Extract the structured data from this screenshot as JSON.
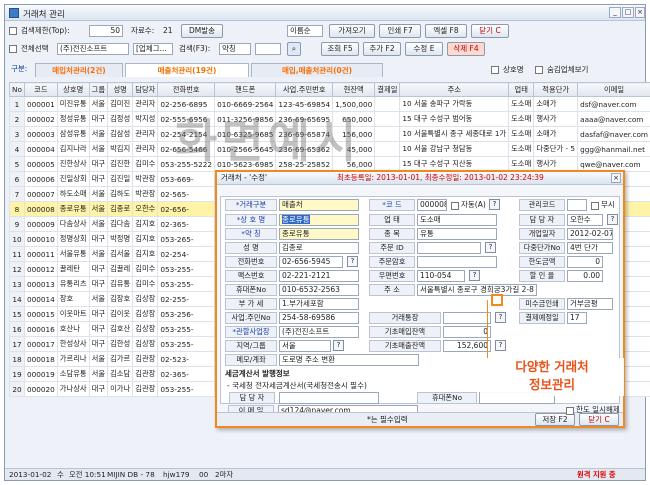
{
  "window": {
    "title": "거래처 관리"
  },
  "toolbar": {
    "chk_search_limit": "검색제한(Top):",
    "limit_value": "50",
    "data_count_label": "자료수:",
    "data_count": "21",
    "dm_button": "DM발송",
    "name_sort": "이름순",
    "btn_import": "가져오기",
    "btn_print": "인쇄 F7",
    "btn_excel": "엑셀 F8",
    "btn_close": "닫기 C",
    "chk_all_select": "전체선택",
    "company": "(주)전진소프트",
    "category": "[업체그...",
    "search_label": "검색(F3):",
    "search_field": "약칭",
    "search_value": "",
    "btn_search": "조회 F5",
    "btn_add": "추가 F2",
    "btn_edit": "수정 E",
    "btn_delete": "삭제 F4"
  },
  "tabs": {
    "label": "구분:",
    "items": [
      "매입처관리(2건)",
      "매출처관리(19건)",
      "매입,매출처관리(0건)"
    ]
  },
  "filters": {
    "chk_sangho": "상호명",
    "chk_show_disabled": "숨김업체보기"
  },
  "grid": {
    "headers": [
      "No",
      "코드",
      "상호명",
      "그룹",
      "성명",
      "담당자",
      "전화번호",
      "핸드폰",
      "사업.주민번호",
      "현잔액",
      "결제일",
      "주소",
      "업태",
      "적용단가",
      "이메일"
    ],
    "rows": [
      [
        "1",
        "000001",
        "미진유통",
        "서울",
        "김미진",
        "관리자",
        "02-256-6895",
        "010-6669-2564",
        "123-45-69854",
        "1,500,000",
        "",
        "10 서울 송파구 가락동",
        "도소매",
        "소매가",
        "dsf@naver.com"
      ],
      [
        "2",
        "000002",
        "정성유통",
        "대구",
        "김정성",
        "박지성",
        "02-555-6956",
        "011-3256-9856",
        "236-69-65695",
        "650,000",
        "",
        "15 대구 수성구 범어동",
        "도소매",
        "행사가",
        "aaaa@naver.com"
      ],
      [
        "3",
        "000003",
        "삼성유통",
        "서울",
        "김삼성",
        "관리자",
        "02-254-2154",
        "010-6325-9685",
        "236-69-65874",
        "156,000",
        "",
        "10 서울특별시 종구 세종대로 1가",
        "도소매",
        "소매가",
        "dasfaf@naver.com"
      ],
      [
        "4",
        "000004",
        "김지나라",
        "서울",
        "박김지",
        "관리자",
        "02-656-5466",
        "010-2566-5645",
        "236-69-65362",
        "45,000",
        "",
        "10 서울 강남구 청담동",
        "도소매",
        "다중단가 - 5",
        "ggg@hanmail.net"
      ],
      [
        "5",
        "000005",
        "진한상사",
        "대구",
        "김진한",
        "김미수",
        "053-255-5222",
        "010-5623-6985",
        "258-25-25852",
        "56,000",
        "",
        "15 대구 수성구 지산동",
        "도소매",
        "행사가",
        "qwe@naver.com"
      ],
      [
        "6",
        "000006",
        "진일상회",
        "대구",
        "김진일",
        "박관장",
        "053-669-",
        "",
        "",
        "",
        "",
        "",
        "",
        "",
        ""
      ],
      [
        "7",
        "000007",
        "하도소매",
        "서울",
        "김하도",
        "박관장",
        "02-565-",
        "",
        "",
        "",
        "",
        "",
        "",
        "",
        ""
      ],
      [
        "8",
        "000008",
        "종로유통",
        "서울",
        "김종로",
        "오한수",
        "02-656-",
        "",
        "",
        "",
        "",
        "",
        "",
        "",
        ""
      ],
      [
        "9",
        "000009",
        "다솜상사",
        "서울",
        "김다솜",
        "김지호",
        "02-365-",
        "",
        "",
        "",
        "",
        "",
        "",
        "",
        ""
      ],
      [
        "10",
        "000010",
        "정명상회",
        "대구",
        "박정명",
        "김지호",
        "053-265-",
        "",
        "",
        "",
        "",
        "",
        "",
        "",
        ""
      ],
      [
        "11",
        "000011",
        "서울유통",
        "서울",
        "김서울",
        "김지호",
        "02-254-",
        "",
        "",
        "",
        "",
        "",
        "",
        "",
        ""
      ],
      [
        "12",
        "000012",
        "꿀레탄",
        "대구",
        "김꿀레",
        "김미수",
        "053-255-",
        "",
        "",
        "",
        "",
        "",
        "",
        "",
        ""
      ],
      [
        "13",
        "000013",
        "유통리츠",
        "대구",
        "김유통",
        "김미수",
        "053-255-",
        "",
        "",
        "",
        "",
        "",
        "",
        "",
        ""
      ],
      [
        "14",
        "000014",
        "장호",
        "서울",
        "김장호",
        "김상장",
        "02-255-",
        "",
        "",
        "",
        "",
        "",
        "",
        "",
        ""
      ],
      [
        "15",
        "000015",
        "이웃마트",
        "대구",
        "김이웃",
        "김상장",
        "053-256-",
        "",
        "",
        "",
        "",
        "",
        "",
        "",
        ""
      ],
      [
        "16",
        "000016",
        "호산나",
        "대구",
        "김호산",
        "김상장",
        "053-255-",
        "",
        "",
        "",
        "",
        "",
        "",
        "",
        ""
      ],
      [
        "17",
        "000017",
        "한성상사",
        "대구",
        "김한성",
        "김상장",
        "053-255-",
        "",
        "",
        "",
        "",
        "",
        "",
        "",
        ""
      ],
      [
        "18",
        "000018",
        "가르리나",
        "서울",
        "김가르",
        "김관장",
        "02-523-",
        "",
        "",
        "",
        "",
        "",
        "",
        "",
        ""
      ],
      [
        "19",
        "000019",
        "소담유통",
        "서울",
        "김소담",
        "김관장",
        "02-365-",
        "",
        "",
        "",
        "",
        "",
        "",
        "",
        ""
      ],
      [
        "20",
        "000020",
        "가나상사",
        "대구",
        "이가나",
        "김관장",
        "053-255-",
        "",
        "",
        "",
        "",
        "",
        "",
        "",
        ""
      ]
    ]
  },
  "watermark": "화면예시",
  "statusbar": {
    "date": "2013-01-02",
    "ampm": "수",
    "time": "오전 10:51",
    "db": "MIJIN DB - 78",
    "user": "hjw179",
    "count": "00",
    "count_label": "2마자",
    "remote": "원격 지원 중"
  },
  "dialog": {
    "title": "거래처 - '수정'",
    "reg_info": "최초등록일: 2013-01-01, 최종수정일: 2013-01-02 23:24:39",
    "f_type": "*거래구분",
    "v_type": "매출처",
    "f_code": "*코 드",
    "v_code": "000008",
    "auto": "자동(A)",
    "f_mgmt": "관리코드",
    "chk_hide": "무시",
    "f_sangho": "*상 호 명",
    "v_sangho": "종로유통",
    "f_upte": "업 태",
    "v_upte": "도소매",
    "f_manager": "담 당 자",
    "v_manager": "오한수",
    "f_short": "*약 칭",
    "v_short": "종로유통",
    "f_jongmok": "종 목",
    "v_jongmok": "유통",
    "f_opendate": "개업일자",
    "v_opendate": "2012-02-07",
    "f_name": "성 명",
    "v_name": "김종로",
    "f_jumin": "주문 ID",
    "f_multi": "다중단가No",
    "v_multi": "4번 단가",
    "f_phone": "전화번호",
    "v_phone": "02-656-5945",
    "f_pw": "주문암호",
    "f_credit": "한도금액",
    "v_credit": "0",
    "f_fax": "팩스번호",
    "v_fax": "02-221-2121",
    "f_zip": "우편번호",
    "v_zip": "110-054",
    "f_discount": "할 인 율",
    "v_discount": "0.00",
    "f_mobile": "휴대폰No",
    "v_mobile": "010-6532-2563",
    "f_addr": "주 소",
    "v_addr": "서울특별시 종로구 경희궁3가길 2-8",
    "f_vat": "부 가 세",
    "v_vat": "1.부가세포함",
    "f_unpaid": "미수금인쇄",
    "v_unpaid": "거부금평",
    "f_bizno": "사업.주민No",
    "v_bizno": "254-58-69586",
    "f_bank": "거래통장",
    "f_payday": "결제예정일",
    "v_payday": "17",
    "f_company": "*관할사업장",
    "v_company": "(주)전진소프트",
    "f_base_unpaid": "기초매입잔액",
    "v_base_unpaid": "0",
    "f_region": "지역/그룹",
    "v_region": "서울",
    "f_base_sales": "기초매출잔액",
    "v_base_sales": "152,600",
    "f_memo": "메모/계좌",
    "v_memo": "도로명 주소 변환",
    "tax_title": "세금계산서 발행정보",
    "tax_sub1": "- 국세청 전자세금계산서(국세청전송시 필수)",
    "f_tax_manager": "담 당 자",
    "f_tax_mobile": "휴대폰No",
    "f_tax_email": "이 메 일",
    "v_tax_email": "sd124@naver.com",
    "tax_sub2": "- e메일계산서(단순 e메일발행)",
    "f_email2": "이 메 일",
    "v_email2": "sd124@naver.com",
    "required_note": "*는 필수입력",
    "btn_save": "저장 F2",
    "btn_close": "닫기 C"
  },
  "right_panel": {
    "chk_zero": "거래명세서 출력시 가격변동출력 제외",
    "chk_limit": "한도 일시해제",
    "chk_stop": "거래중지",
    "chk_mgmt": "관리연람(숨김)"
  },
  "callout": {
    "line1": "다양한 거래처",
    "line2": "정보관리"
  }
}
